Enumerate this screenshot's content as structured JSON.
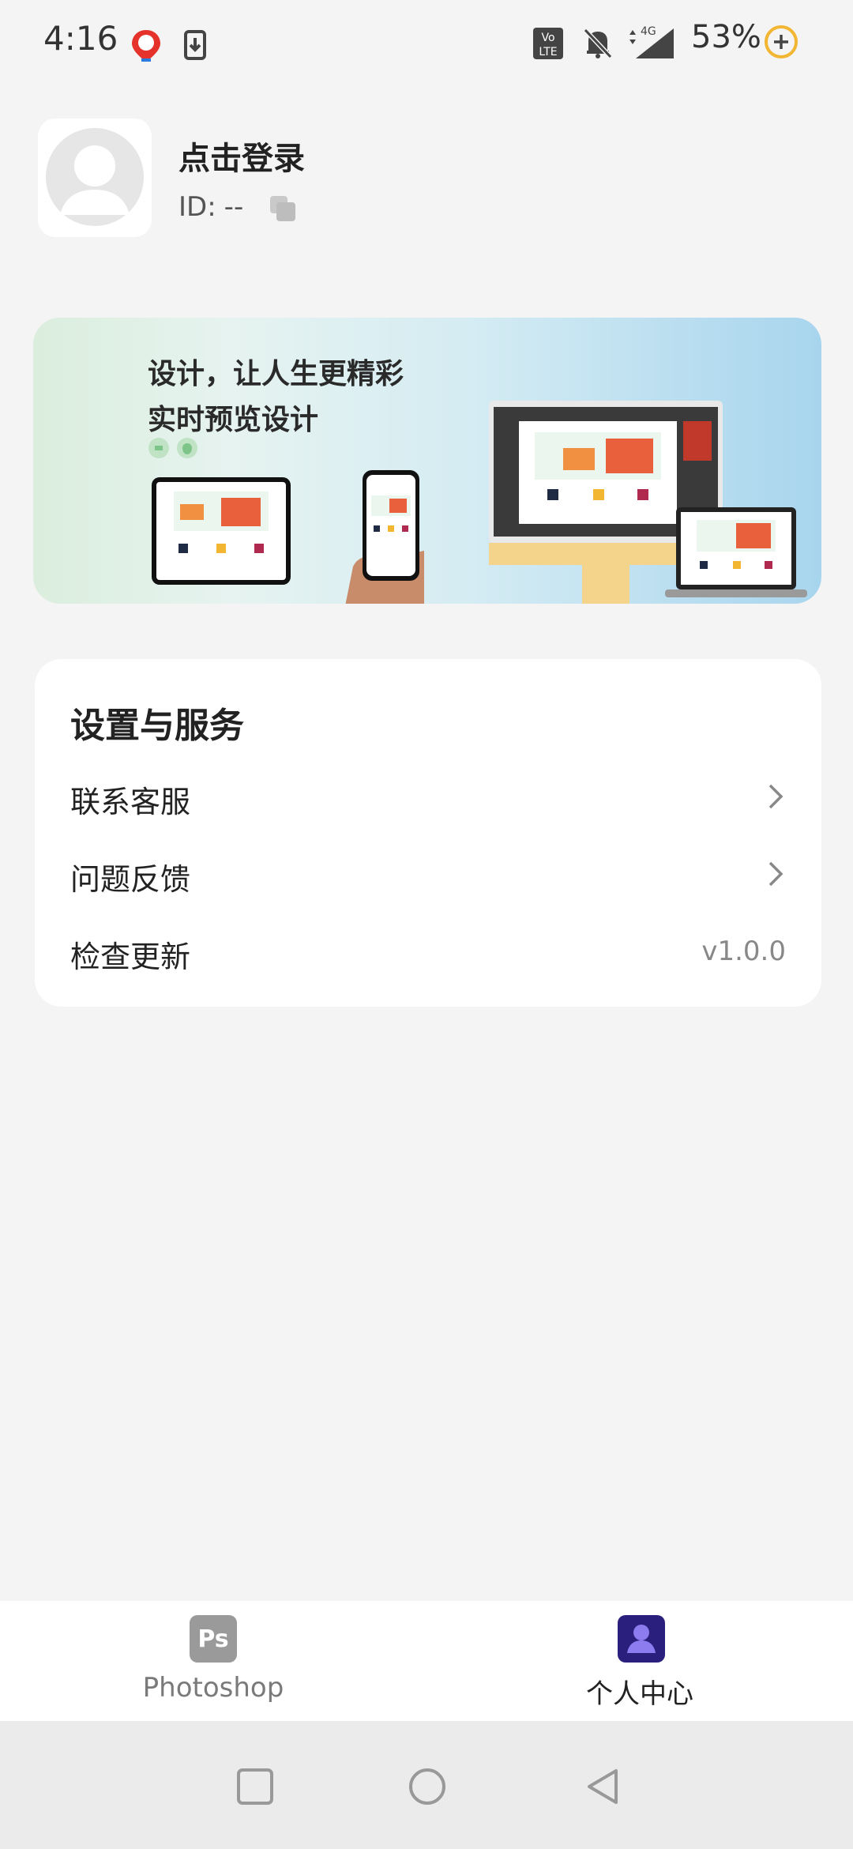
{
  "status_bar": {
    "time": "4:16",
    "battery": "53%",
    "icons": [
      "baidu-maps-icon",
      "download-icon",
      "volte-icon",
      "bell-muted-icon",
      "signal-4g-icon",
      "battery-saver-icon"
    ]
  },
  "profile": {
    "login_text": "点击登录",
    "id_label": "ID:",
    "id_value": "--"
  },
  "banner": {
    "line1": "设计，让人生更精彩",
    "line2": "实时预览设计"
  },
  "settings": {
    "title": "设置与服务",
    "items": [
      {
        "label": "联系客服",
        "icon": "chevron-right-icon"
      },
      {
        "label": "问题反馈",
        "icon": "chevron-right-icon"
      },
      {
        "label": "检查更新",
        "value": "v1.0.0"
      }
    ]
  },
  "tabs": [
    {
      "label": "Photoshop",
      "icon_text": "Ps",
      "active": false
    },
    {
      "label": "个人中心",
      "active": true
    }
  ],
  "colors": {
    "accent": "#2b1f7d",
    "ps_icon": "#9a9a9a",
    "inactive_label": "#7a7a7a"
  }
}
